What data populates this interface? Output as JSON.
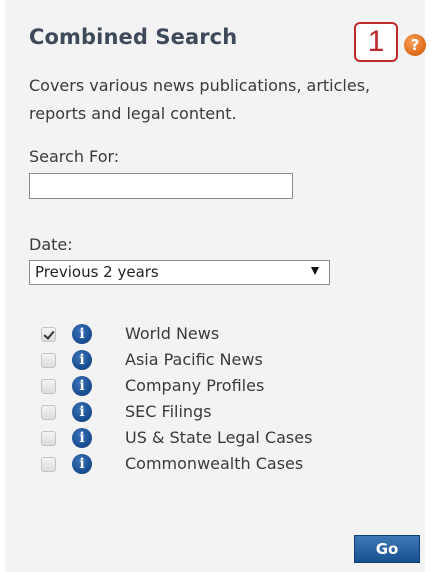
{
  "widget": {
    "title": "Combined Search",
    "callout_number": "1",
    "help_glyph": "?",
    "description": "Covers various news publications, articles, reports and legal content."
  },
  "search": {
    "label": "Search For:",
    "value": "",
    "placeholder": ""
  },
  "date": {
    "label": "Date:",
    "selected": "Previous 2 years"
  },
  "sources": {
    "info_glyph": "i",
    "items": [
      {
        "label": "World News",
        "checked": true
      },
      {
        "label": "Asia Pacific News",
        "checked": false
      },
      {
        "label": "Company Profiles",
        "checked": false
      },
      {
        "label": "SEC Filings",
        "checked": false
      },
      {
        "label": "US & State Legal Cases",
        "checked": false
      },
      {
        "label": "Commonwealth Cases",
        "checked": false
      }
    ]
  },
  "actions": {
    "go_label": "Go"
  },
  "colors": {
    "title": "#3e4a5a",
    "callout": "#c0282d",
    "help_icon": "#e2701f",
    "info_icon": "#1b4f93",
    "go_button": "#17528f",
    "panel_bg": "#f3f3f3"
  },
  "icons": {
    "help": "question-mark-icon",
    "info": "info-icon",
    "checkbox": "checkbox-icon",
    "dropdown": "chevron-down-icon"
  }
}
